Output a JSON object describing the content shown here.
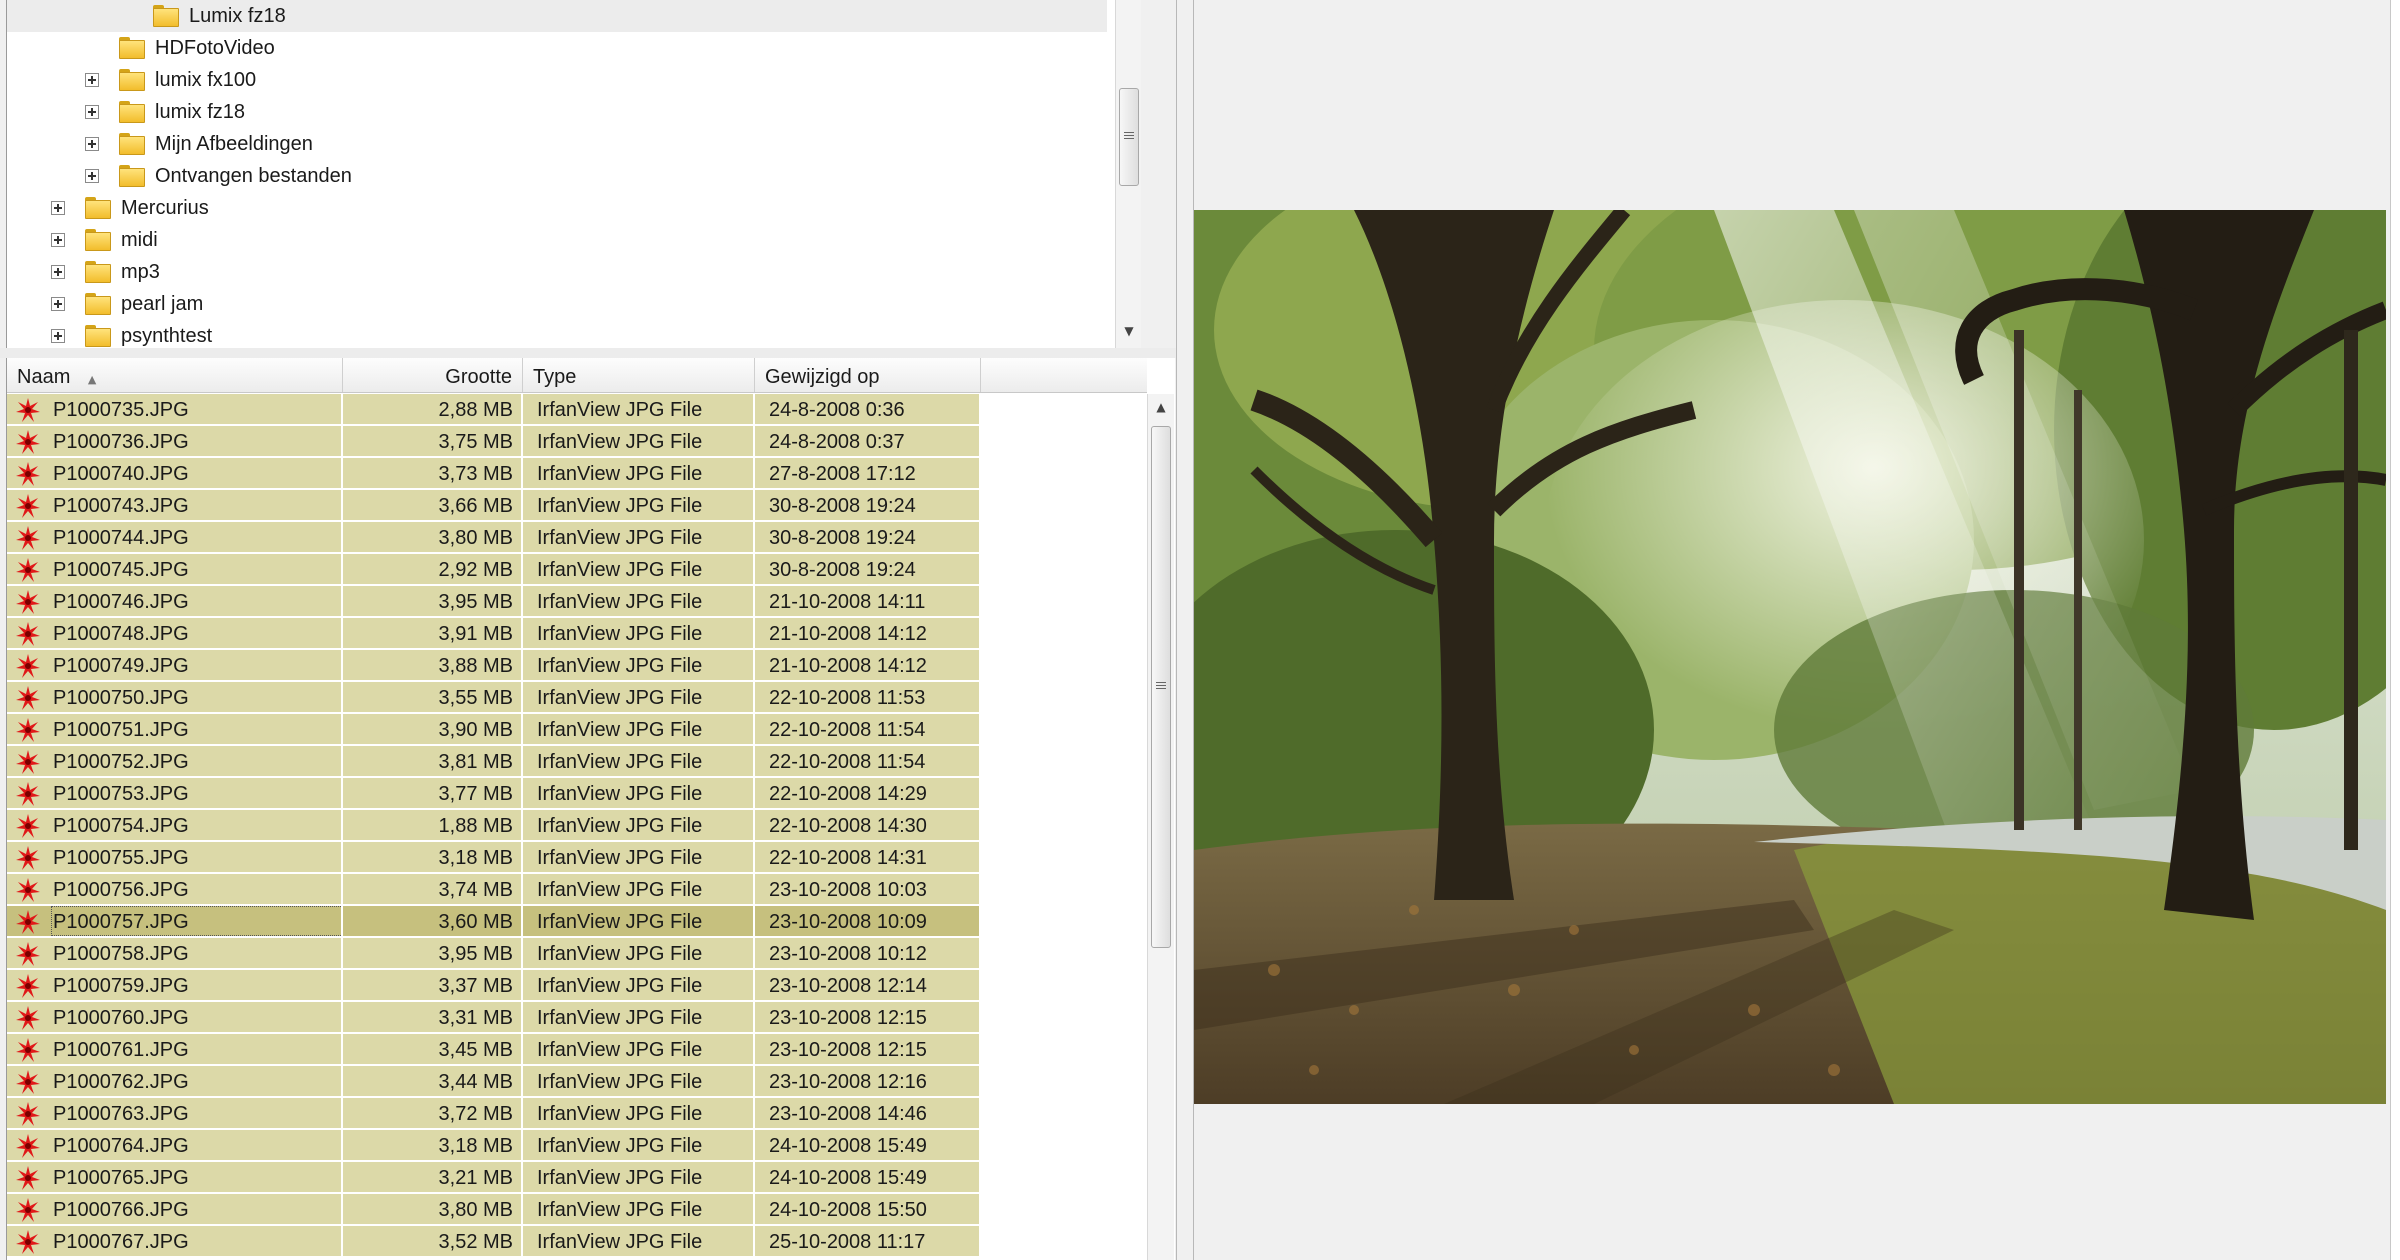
{
  "tree": {
    "items": [
      {
        "label": "Lumix fz18",
        "level": 3,
        "expander": false,
        "selected": true
      },
      {
        "label": "HDFotoVideo",
        "level": 2,
        "expander": false,
        "selected": false
      },
      {
        "label": "lumix fx100",
        "level": 2,
        "expander": true,
        "selected": false
      },
      {
        "label": "lumix fz18",
        "level": 2,
        "expander": true,
        "selected": false
      },
      {
        "label": "Mijn Afbeeldingen",
        "level": 2,
        "expander": true,
        "selected": false
      },
      {
        "label": "Ontvangen bestanden",
        "level": 2,
        "expander": true,
        "selected": false
      },
      {
        "label": "Mercurius",
        "level": 1,
        "expander": true,
        "selected": false
      },
      {
        "label": "midi",
        "level": 1,
        "expander": true,
        "selected": false
      },
      {
        "label": "mp3",
        "level": 1,
        "expander": true,
        "selected": false
      },
      {
        "label": "pearl jam",
        "level": 1,
        "expander": true,
        "selected": false
      },
      {
        "label": "psynthtest",
        "level": 1,
        "expander": true,
        "selected": false
      }
    ]
  },
  "file_list": {
    "columns": {
      "name": "Naam",
      "size": "Grootte",
      "type": "Type",
      "modified": "Gewijzigd op"
    },
    "sort_indicator": "▲",
    "selected_row": 16,
    "rows": [
      {
        "name": "P1000735.JPG",
        "size": "2,88 MB",
        "type": "IrfanView JPG File",
        "modified": "24-8-2008 0:36"
      },
      {
        "name": "P1000736.JPG",
        "size": "3,75 MB",
        "type": "IrfanView JPG File",
        "modified": "24-8-2008 0:37"
      },
      {
        "name": "P1000740.JPG",
        "size": "3,73 MB",
        "type": "IrfanView JPG File",
        "modified": "27-8-2008 17:12"
      },
      {
        "name": "P1000743.JPG",
        "size": "3,66 MB",
        "type": "IrfanView JPG File",
        "modified": "30-8-2008 19:24"
      },
      {
        "name": "P1000744.JPG",
        "size": "3,80 MB",
        "type": "IrfanView JPG File",
        "modified": "30-8-2008 19:24"
      },
      {
        "name": "P1000745.JPG",
        "size": "2,92 MB",
        "type": "IrfanView JPG File",
        "modified": "30-8-2008 19:24"
      },
      {
        "name": "P1000746.JPG",
        "size": "3,95 MB",
        "type": "IrfanView JPG File",
        "modified": "21-10-2008 14:11"
      },
      {
        "name": "P1000748.JPG",
        "size": "3,91 MB",
        "type": "IrfanView JPG File",
        "modified": "21-10-2008 14:12"
      },
      {
        "name": "P1000749.JPG",
        "size": "3,88 MB",
        "type": "IrfanView JPG File",
        "modified": "21-10-2008 14:12"
      },
      {
        "name": "P1000750.JPG",
        "size": "3,55 MB",
        "type": "IrfanView JPG File",
        "modified": "22-10-2008 11:53"
      },
      {
        "name": "P1000751.JPG",
        "size": "3,90 MB",
        "type": "IrfanView JPG File",
        "modified": "22-10-2008 11:54"
      },
      {
        "name": "P1000752.JPG",
        "size": "3,81 MB",
        "type": "IrfanView JPG File",
        "modified": "22-10-2008 11:54"
      },
      {
        "name": "P1000753.JPG",
        "size": "3,77 MB",
        "type": "IrfanView JPG File",
        "modified": "22-10-2008 14:29"
      },
      {
        "name": "P1000754.JPG",
        "size": "1,88 MB",
        "type": "IrfanView JPG File",
        "modified": "22-10-2008 14:30"
      },
      {
        "name": "P1000755.JPG",
        "size": "3,18 MB",
        "type": "IrfanView JPG File",
        "modified": "22-10-2008 14:31"
      },
      {
        "name": "P1000756.JPG",
        "size": "3,74 MB",
        "type": "IrfanView JPG File",
        "modified": "23-10-2008 10:03"
      },
      {
        "name": "P1000757.JPG",
        "size": "3,60 MB",
        "type": "IrfanView JPG File",
        "modified": "23-10-2008 10:09"
      },
      {
        "name": "P1000758.JPG",
        "size": "3,95 MB",
        "type": "IrfanView JPG File",
        "modified": "23-10-2008 10:12"
      },
      {
        "name": "P1000759.JPG",
        "size": "3,37 MB",
        "type": "IrfanView JPG File",
        "modified": "23-10-2008 12:14"
      },
      {
        "name": "P1000760.JPG",
        "size": "3,31 MB",
        "type": "IrfanView JPG File",
        "modified": "23-10-2008 12:15"
      },
      {
        "name": "P1000761.JPG",
        "size": "3,45 MB",
        "type": "IrfanView JPG File",
        "modified": "23-10-2008 12:15"
      },
      {
        "name": "P1000762.JPG",
        "size": "3,44 MB",
        "type": "IrfanView JPG File",
        "modified": "23-10-2008 12:16"
      },
      {
        "name": "P1000763.JPG",
        "size": "3,72 MB",
        "type": "IrfanView JPG File",
        "modified": "23-10-2008 14:46"
      },
      {
        "name": "P1000764.JPG",
        "size": "3,18 MB",
        "type": "IrfanView JPG File",
        "modified": "24-10-2008 15:49"
      },
      {
        "name": "P1000765.JPG",
        "size": "3,21 MB",
        "type": "IrfanView JPG File",
        "modified": "24-10-2008 15:49"
      },
      {
        "name": "P1000766.JPG",
        "size": "3,80 MB",
        "type": "IrfanView JPG File",
        "modified": "24-10-2008 15:50"
      },
      {
        "name": "P1000767.JPG",
        "size": "3,52 MB",
        "type": "IrfanView JPG File",
        "modified": "25-10-2008 11:17"
      }
    ]
  },
  "icons": {
    "folder": "folder-icon",
    "expander": "plus-box-icon",
    "file": "irfanview-file-icon",
    "scroll_up": "▲",
    "scroll_down": "▼"
  },
  "colors": {
    "row_highlight": "#dcd9a8",
    "row_selected": "#c6c07e",
    "folder": "#f2bd2c",
    "file_icon": "#e01818"
  },
  "preview": {
    "icon": "photo-preview",
    "subject": "forest-path-with-sunbeams"
  }
}
